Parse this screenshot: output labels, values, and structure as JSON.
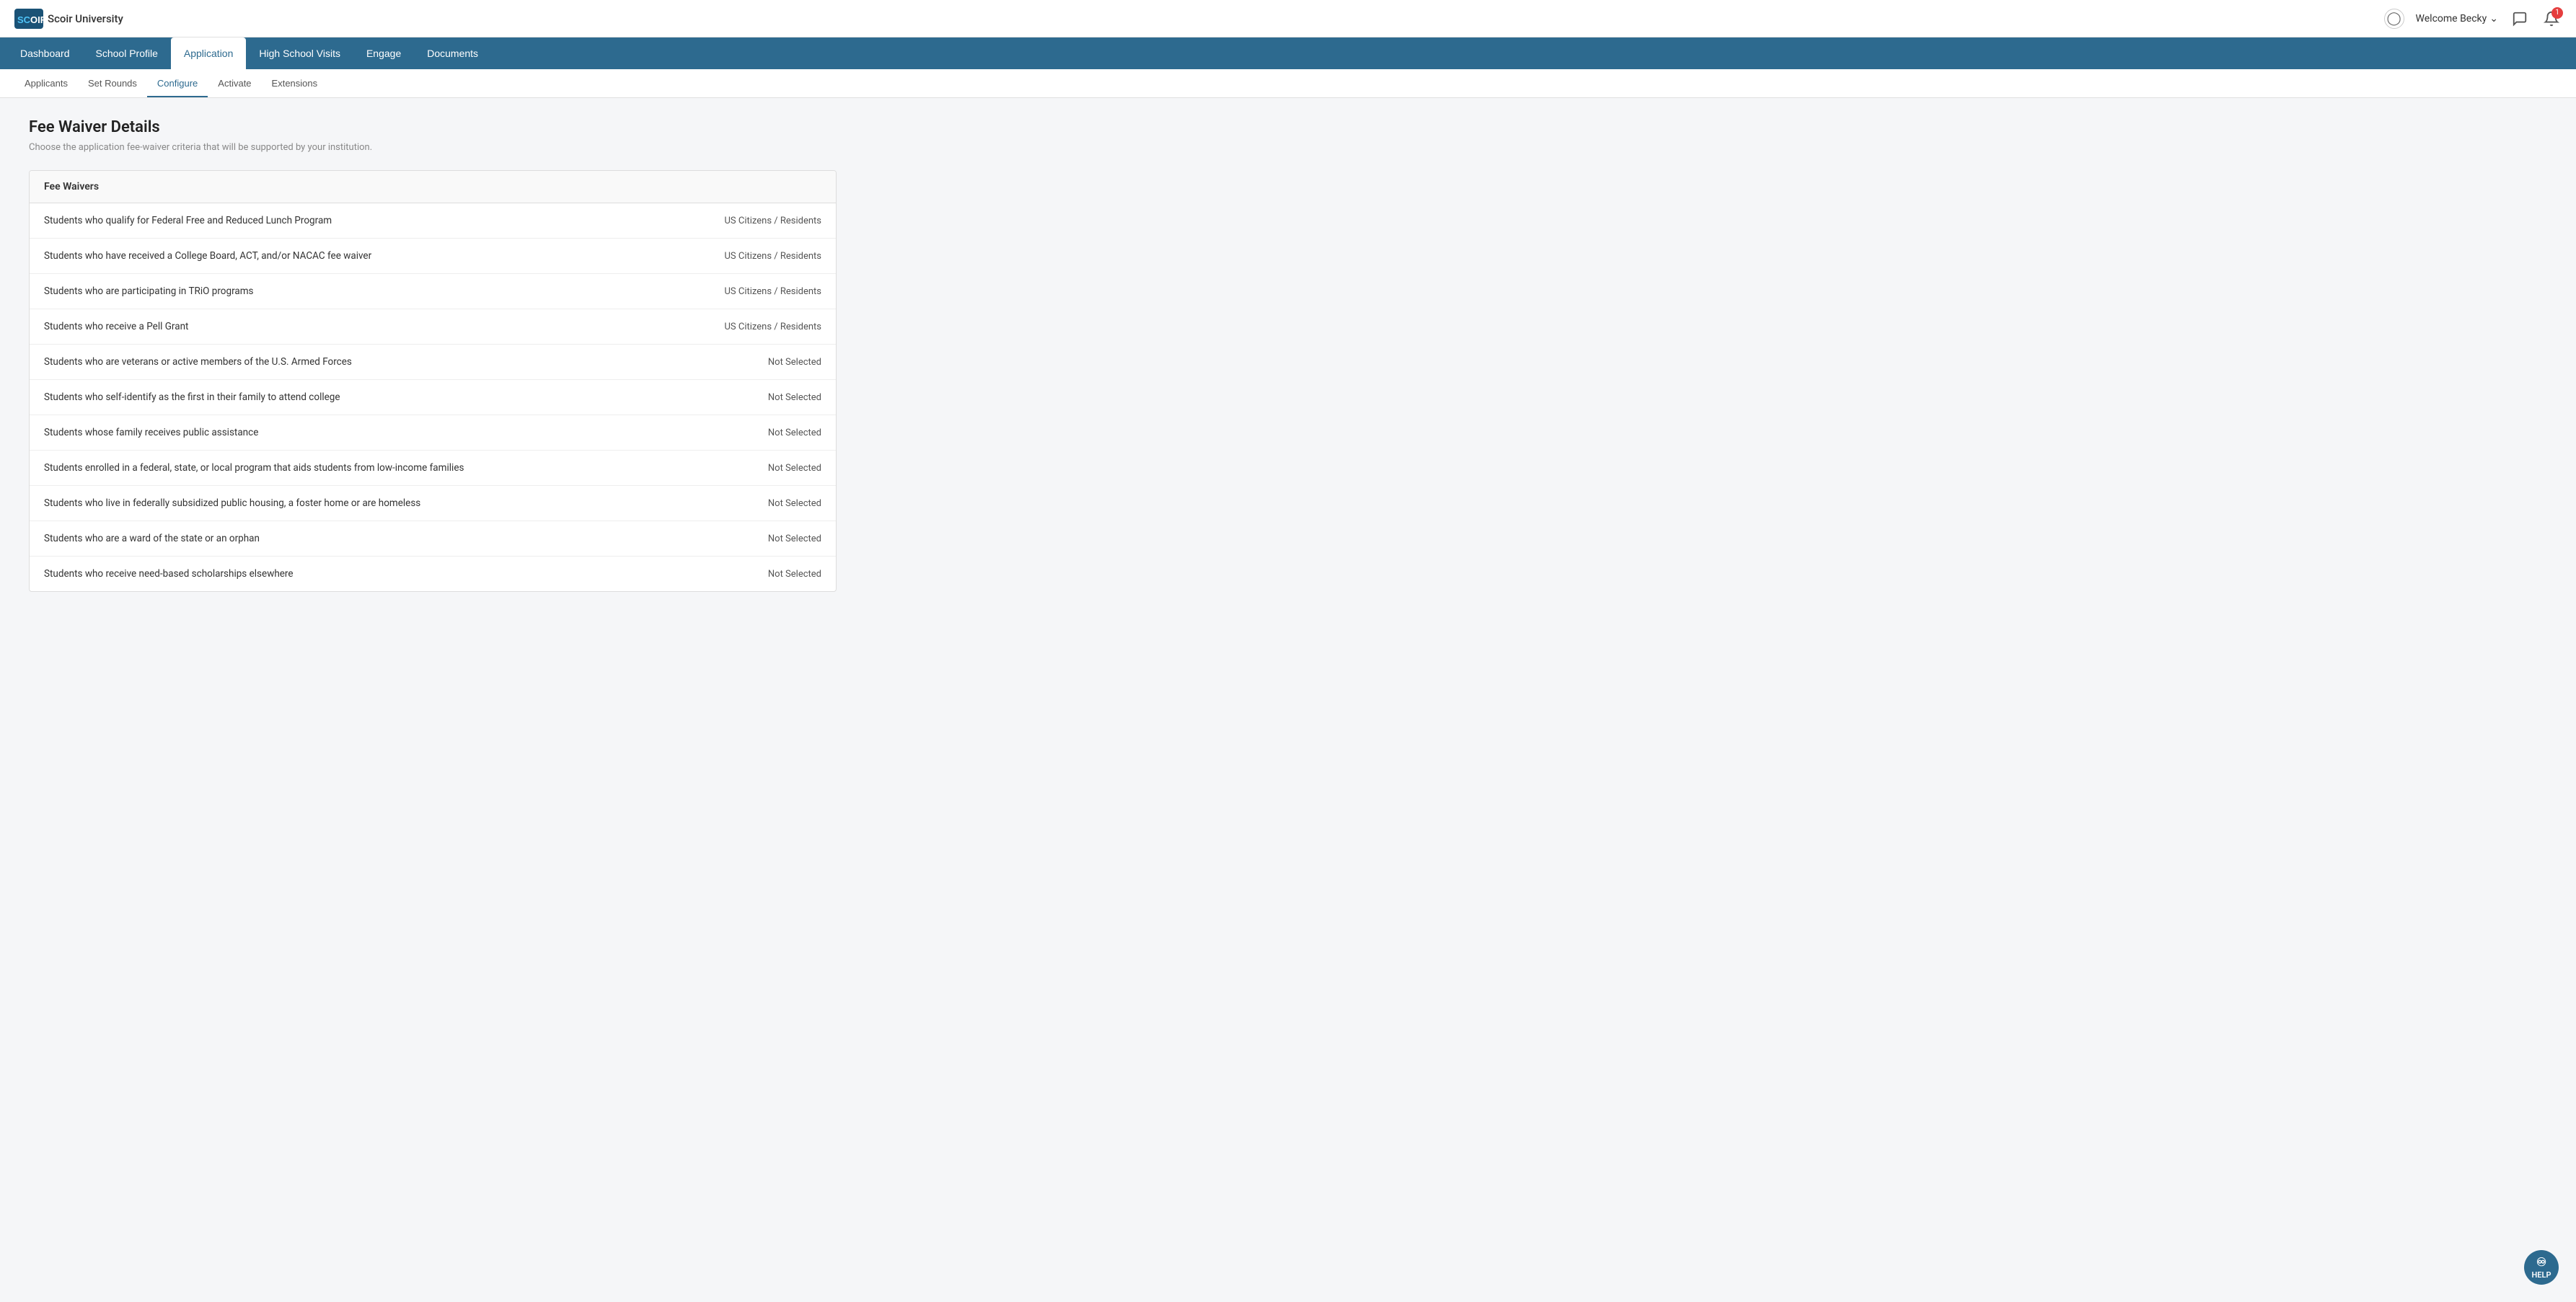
{
  "app": {
    "logo_text": "SCOIR",
    "university_name": "Scoir University"
  },
  "header": {
    "welcome_label": "Welcome Becky",
    "notification_count": "1"
  },
  "primary_nav": {
    "items": [
      {
        "id": "dashboard",
        "label": "Dashboard",
        "active": false
      },
      {
        "id": "school-profile",
        "label": "School Profile",
        "active": false
      },
      {
        "id": "application",
        "label": "Application",
        "active": true
      },
      {
        "id": "high-school-visits",
        "label": "High School Visits",
        "active": false
      },
      {
        "id": "engage",
        "label": "Engage",
        "active": false
      },
      {
        "id": "documents",
        "label": "Documents",
        "active": false
      }
    ]
  },
  "secondary_nav": {
    "items": [
      {
        "id": "applicants",
        "label": "Applicants",
        "active": false
      },
      {
        "id": "set-rounds",
        "label": "Set Rounds",
        "active": false
      },
      {
        "id": "configure",
        "label": "Configure",
        "active": true
      },
      {
        "id": "activate",
        "label": "Activate",
        "active": false
      },
      {
        "id": "extensions",
        "label": "Extensions",
        "active": false
      }
    ]
  },
  "page": {
    "title": "Fee Waiver Details",
    "subtitle": "Choose the application fee-waiver criteria that will be supported by your institution."
  },
  "fee_waivers_table": {
    "header_label": "Fee Waivers",
    "rows": [
      {
        "label": "Students who qualify for Federal Free and Reduced Lunch Program",
        "status": "US Citizens / Residents"
      },
      {
        "label": "Students who have received a College Board, ACT, and/or NACAC fee waiver",
        "status": "US Citizens / Residents"
      },
      {
        "label": "Students who are participating in TRiO programs",
        "status": "US Citizens / Residents"
      },
      {
        "label": "Students who receive a Pell Grant",
        "status": "US Citizens / Residents"
      },
      {
        "label": "Students who are veterans or active members of the U.S. Armed Forces",
        "status": "Not Selected"
      },
      {
        "label": "Students who self-identify as the first in their family to attend college",
        "status": "Not Selected"
      },
      {
        "label": "Students whose family receives public assistance",
        "status": "Not Selected"
      },
      {
        "label": "Students enrolled in a federal, state, or local program that aids students from low-income families",
        "status": "Not Selected"
      },
      {
        "label": "Students who live in federally subsidized public housing, a foster home or are homeless",
        "status": "Not Selected"
      },
      {
        "label": "Students who are a ward of the state or an orphan",
        "status": "Not Selected"
      },
      {
        "label": "Students who receive need-based scholarships elsewhere",
        "status": "Not Selected"
      }
    ]
  },
  "help": {
    "label": "HELP"
  }
}
